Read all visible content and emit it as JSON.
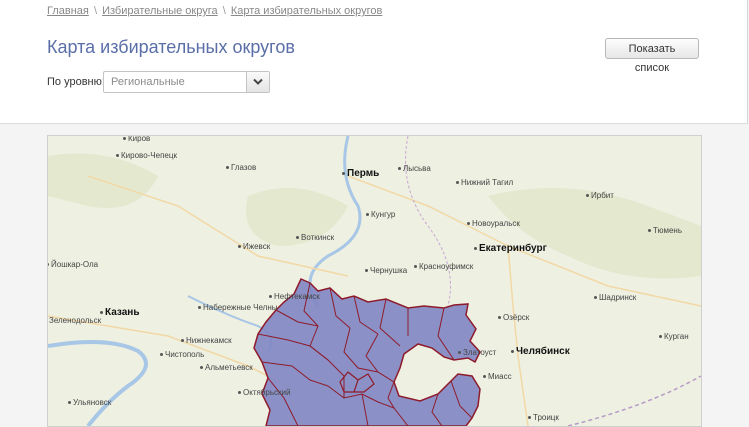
{
  "breadcrumb": {
    "home": "Главная",
    "districts": "Избирательные округа",
    "current": "Карта избирательных округов",
    "separator": "\\"
  },
  "page_title": "Карта избирательных округов",
  "show_list_button": "Показать список",
  "level": {
    "label": "По уровню:",
    "selected": "Региональные"
  },
  "map": {
    "district_fill": "#7f86c3",
    "district_border": "#8e1b2b",
    "cities": [
      {
        "name": "Киров",
        "major": false
      },
      {
        "name": "Кирово-Чепецк",
        "major": false
      },
      {
        "name": "Глазов",
        "major": false
      },
      {
        "name": "Пермь",
        "major": true
      },
      {
        "name": "Лысьва",
        "major": false
      },
      {
        "name": "Нижний Тагил",
        "major": false
      },
      {
        "name": "Ирбит",
        "major": false
      },
      {
        "name": "Кунгур",
        "major": false
      },
      {
        "name": "Новоуральск",
        "major": false
      },
      {
        "name": "Воткинск",
        "major": false
      },
      {
        "name": "Ижевск",
        "major": false
      },
      {
        "name": "Екатеринбург",
        "major": true
      },
      {
        "name": "Тюмень",
        "major": false
      },
      {
        "name": "Йошкар-Ола",
        "major": false
      },
      {
        "name": "Чернушка",
        "major": false
      },
      {
        "name": "Красноуфимск",
        "major": false
      },
      {
        "name": "Нефтекамск",
        "major": false
      },
      {
        "name": "Казань",
        "major": true
      },
      {
        "name": "Набережные Челны",
        "major": false
      },
      {
        "name": "Шадринск",
        "major": false
      },
      {
        "name": "Озёрск",
        "major": false
      },
      {
        "name": "Зеленодольск",
        "major": false
      },
      {
        "name": "Нижнекамск",
        "major": false
      },
      {
        "name": "Златоуст",
        "major": false
      },
      {
        "name": "Челябинск",
        "major": true
      },
      {
        "name": "Курган",
        "major": false
      },
      {
        "name": "Чистополь",
        "major": false
      },
      {
        "name": "Альметьевск",
        "major": false
      },
      {
        "name": "Миасс",
        "major": false
      },
      {
        "name": "Октябрьский",
        "major": false
      },
      {
        "name": "Ульяновск",
        "major": false
      },
      {
        "name": "Троицк",
        "major": false
      }
    ]
  }
}
